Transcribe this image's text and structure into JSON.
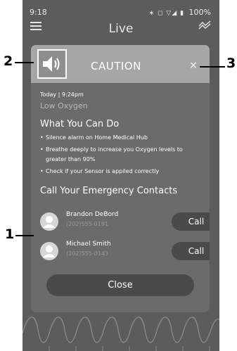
{
  "status_bar": {
    "time": "9:18",
    "icons": "∗ ◻ ▽◢ ▮",
    "battery": "100%"
  },
  "app_bar": {
    "title": "Live"
  },
  "alert": {
    "header_title": "CAUTION",
    "close_symbol": "×",
    "timestamp": "Today | 9:24pm",
    "type": "Low Oxygen",
    "actions_title": "What You Can Do",
    "actions": [
      "Silence alarm on Home Medical Hub",
      "Breathe deeply to increase you Oxygen levels to greater than 90%",
      "Check if your Sensor is appiled correctly"
    ],
    "contacts_title": "Call Your Emergency Contacts",
    "contacts": [
      {
        "name": "Brandon DeBord",
        "phone": "(202)555-0191",
        "call_label": "Call"
      },
      {
        "name": "Michael Smith",
        "phone": "(202)555-0143",
        "call_label": "Call"
      }
    ],
    "close_label": "Close"
  },
  "annotations": {
    "callout_1": "1",
    "callout_2": "2",
    "callout_3": "3"
  }
}
